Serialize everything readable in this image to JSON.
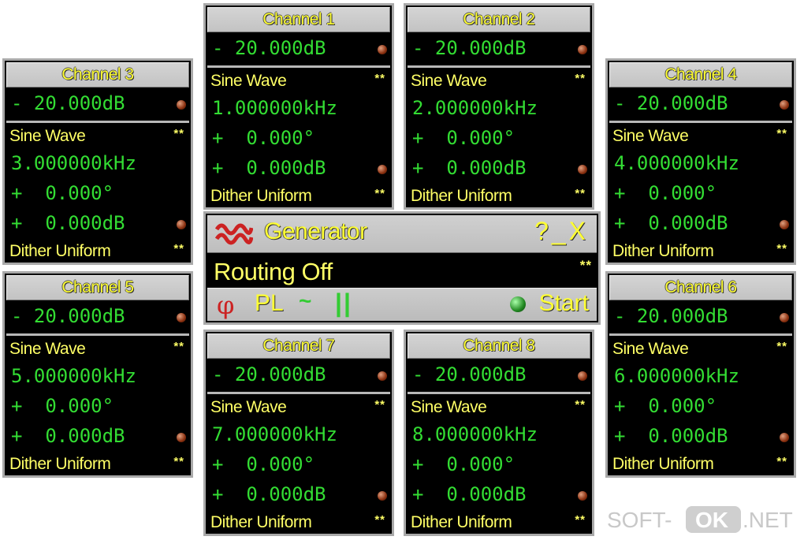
{
  "channels": [
    {
      "name": "Channel 1",
      "level": "- 20.000dB",
      "waveform": "Sine Wave",
      "freq": "1.000000kHz",
      "phase": "+  0.000°",
      "offset": "+  0.000dB",
      "dither": "Dither Uniform",
      "flag": "**"
    },
    {
      "name": "Channel 2",
      "level": "- 20.000dB",
      "waveform": "Sine Wave",
      "freq": "2.000000kHz",
      "phase": "+  0.000°",
      "offset": "+  0.000dB",
      "dither": "Dither Uniform",
      "flag": "**"
    },
    {
      "name": "Channel 3",
      "level": "- 20.000dB",
      "waveform": "Sine Wave",
      "freq": "3.000000kHz",
      "phase": "+  0.000°",
      "offset": "+  0.000dB",
      "dither": "Dither Uniform",
      "flag": "**"
    },
    {
      "name": "Channel 4",
      "level": "- 20.000dB",
      "waveform": "Sine Wave",
      "freq": "4.000000kHz",
      "phase": "+  0.000°",
      "offset": "+  0.000dB",
      "dither": "Dither Uniform",
      "flag": "**"
    },
    {
      "name": "Channel 5",
      "level": "- 20.000dB",
      "waveform": "Sine Wave",
      "freq": "5.000000kHz",
      "phase": "+  0.000°",
      "offset": "+  0.000dB",
      "dither": "Dither Uniform",
      "flag": "**"
    },
    {
      "name": "Channel 6",
      "level": "- 20.000dB",
      "waveform": "Sine Wave",
      "freq": "6.000000kHz",
      "phase": "+  0.000°",
      "offset": "+  0.000dB",
      "dither": "Dither Uniform",
      "flag": "**"
    },
    {
      "name": "Channel 7",
      "level": "- 20.000dB",
      "waveform": "Sine Wave",
      "freq": "7.000000kHz",
      "phase": "+  0.000°",
      "offset": "+  0.000dB",
      "dither": "Dither Uniform",
      "flag": "**"
    },
    {
      "name": "Channel 8",
      "level": "- 20.000dB",
      "waveform": "Sine Wave",
      "freq": "8.000000kHz",
      "phase": "+  0.000°",
      "offset": "+  0.000dB",
      "dither": "Dither Uniform",
      "flag": "**"
    }
  ],
  "generator": {
    "title": "Generator",
    "help_label": "?",
    "minimize_label": "_",
    "close_label": "X",
    "routing": "Routing Off",
    "flag": "**",
    "phase_symbol": "φ",
    "pl_label": "PL",
    "tilde_label": "~",
    "pause_label": "||",
    "start_label": "Start",
    "logo_icon": "waveform-logo-icon",
    "logo_color": "#cc2222"
  },
  "watermark": {
    "part1": "SOFT-",
    "part2": "OK",
    "part3": ".NET"
  },
  "colors": {
    "value_green": "#33dd33",
    "label_yellow": "#ffff66",
    "panel_bg": "#000000",
    "frame_gray": "#a9a9a9"
  }
}
